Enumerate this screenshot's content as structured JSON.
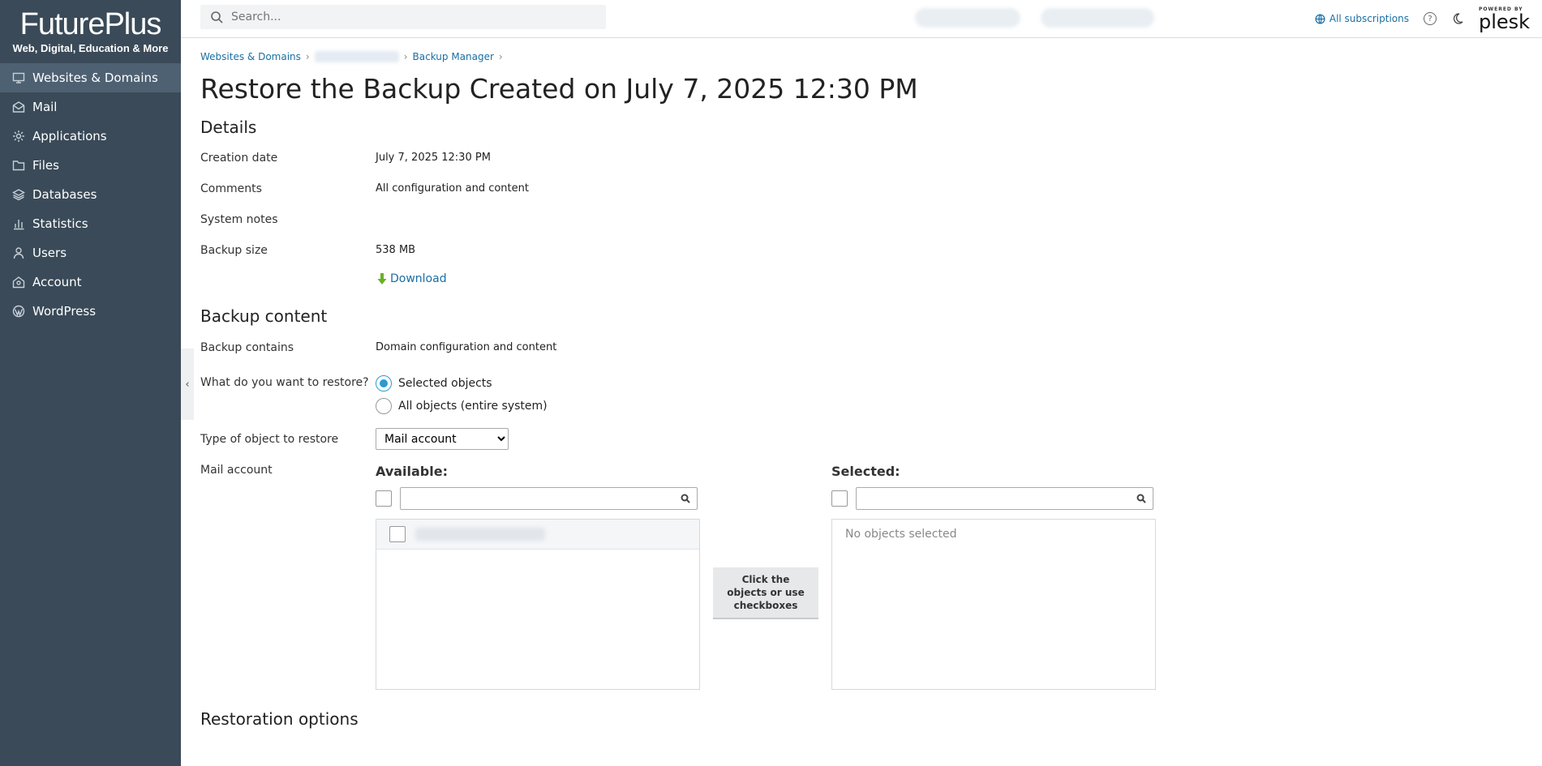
{
  "brand": {
    "title": "FuturePlus",
    "subtitle": "Web, Digital, Education & More"
  },
  "sidebar": {
    "items": [
      {
        "label": "Websites & Domains",
        "icon": "monitor-icon",
        "active": true
      },
      {
        "label": "Mail",
        "icon": "envelope-icon"
      },
      {
        "label": "Applications",
        "icon": "gear-icon"
      },
      {
        "label": "Files",
        "icon": "folder-icon"
      },
      {
        "label": "Databases",
        "icon": "layers-icon"
      },
      {
        "label": "Statistics",
        "icon": "bar-chart-icon"
      },
      {
        "label": "Users",
        "icon": "user-icon"
      },
      {
        "label": "Account",
        "icon": "account-icon"
      },
      {
        "label": "WordPress",
        "icon": "wordpress-icon"
      }
    ]
  },
  "topbar": {
    "search_placeholder": "Search...",
    "subscriptions_label": "All subscriptions",
    "help_symbol": "?",
    "powered_by": "POWERED BY",
    "plesk": "plesk"
  },
  "breadcrumb": {
    "item1": "Websites & Domains",
    "item3": "Backup Manager",
    "sep": "›"
  },
  "page": {
    "title": "Restore the Backup Created on July 7, 2025 12:30 PM"
  },
  "details": {
    "heading": "Details",
    "creation_date_label": "Creation date",
    "creation_date_value": "July 7, 2025 12:30 PM",
    "comments_label": "Comments",
    "comments_value": "All configuration and content",
    "system_notes_label": "System notes",
    "backup_size_label": "Backup size",
    "backup_size_value": "538 MB",
    "download_label": "Download"
  },
  "content": {
    "heading": "Backup content",
    "contains_label": "Backup contains",
    "contains_value": "Domain configuration and content",
    "restore_question": "What do you want to restore?",
    "option_selected": "Selected objects",
    "option_all": "All objects (entire system)",
    "type_label": "Type of object to restore",
    "type_value": "Mail account",
    "mail_account_label": "Mail account",
    "available_title": "Available:",
    "selected_title": "Selected:",
    "no_objects": "No objects selected",
    "mid_button": "Click the objects or use checkboxes"
  },
  "restoration": {
    "heading": "Restoration options"
  }
}
